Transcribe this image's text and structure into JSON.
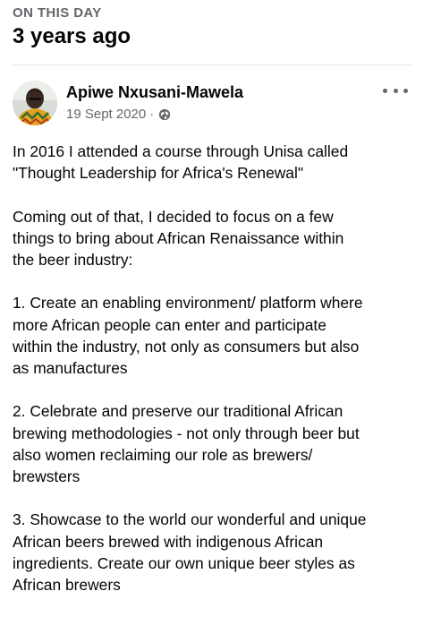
{
  "memory": {
    "eyebrow": "ON THIS DAY",
    "title": "3 years ago"
  },
  "post": {
    "author": "Apiwe Nxusani-Mawela",
    "date": "19 Sept 2020",
    "separator": "·",
    "privacy_icon": "globe-icon",
    "more_icon": "more-options-icon",
    "paragraphs": [
      "In 2016 I attended a course through Unisa called\n\"Thought Leadership for Africa's Renewal\"",
      "Coming out of that, I decided to focus on a few\nthings to bring about African Renaissance within\nthe beer industry:",
      "1. Create an enabling environment/ platform where\nmore African people can enter and participate\nwithin the industry, not only as consumers but also\nas manufactures",
      "2. Celebrate and preserve our traditional African\nbrewing methodologies - not only through beer but\nalso women reclaiming our role as brewers/\nbrewsters",
      "3. Showcase to the world our wonderful and unique\nAfrican beers brewed with indigenous African\ningredients. Create our own unique beer styles as\nAfrican brewers"
    ]
  },
  "colors": {
    "text_primary": "#050505",
    "text_secondary": "#65676b",
    "divider": "#e4e6eb"
  }
}
